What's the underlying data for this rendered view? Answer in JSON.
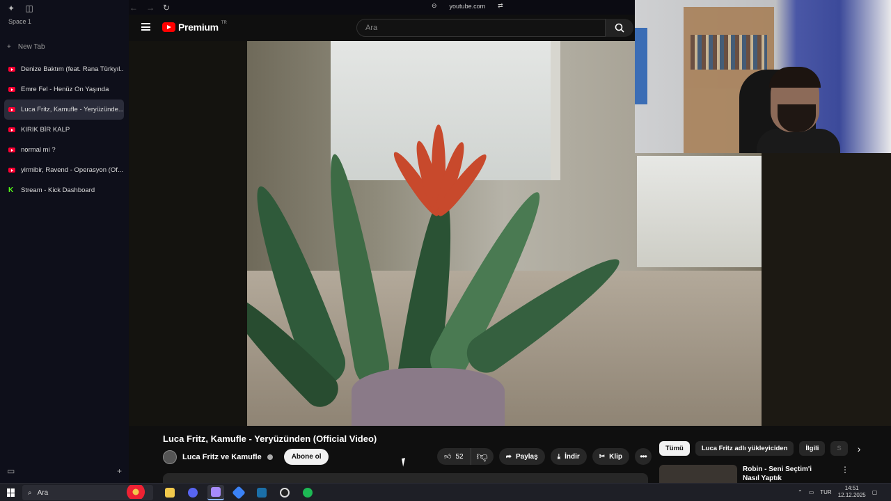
{
  "browser": {
    "space_label": "Space 1",
    "address": "youtube.com",
    "new_tab_label": "New Tab",
    "tabs": [
      {
        "label": "Denize Baktım (feat. Rana Türkyıl...",
        "favicon": "youtube-icon",
        "active": false
      },
      {
        "label": "Emre Fel - Henüz On Yaşında",
        "favicon": "youtube-icon",
        "active": false
      },
      {
        "label": "Luca Fritz, Kamufle - Yeryüzünde...",
        "favicon": "youtube-icon",
        "active": true
      },
      {
        "label": "KIRIK BİR KALP",
        "favicon": "youtube-icon",
        "active": false
      },
      {
        "label": "normal mi ?",
        "favicon": "youtube-icon",
        "active": false
      },
      {
        "label": "yirmibir, Ravend - Operasyon (Of...",
        "favicon": "youtube-icon",
        "active": false
      },
      {
        "label": "Stream - Kick Dashboard",
        "favicon": "kick-icon",
        "active": false
      }
    ]
  },
  "youtube": {
    "logo_text": "Premium",
    "logo_sup": "TR",
    "search_placeholder": "Ara",
    "video": {
      "title": "Luca Fritz, Kamufle - Yeryüzünden (Official Video)",
      "channel": "Luca Fritz ve Kamufle",
      "subscribe_label": "Abone ol",
      "likes": "52",
      "share_label": "Paylaş",
      "download_label": "İndir",
      "clip_label": "Klip"
    },
    "chips": [
      "Tümü",
      "Luca Fritz adlı yükleyiciden",
      "İlgili",
      "S"
    ],
    "recommendation": {
      "title": "Robin - Seni Seçtim'i Nasıl Yaptık"
    }
  },
  "taskbar": {
    "search_placeholder": "Ara",
    "language": "TUR",
    "time": "14:51",
    "date": "12.12.2025"
  },
  "colors": {
    "accent": "#ff0000",
    "kick": "#53fc18",
    "background": "#0f0f0f"
  }
}
